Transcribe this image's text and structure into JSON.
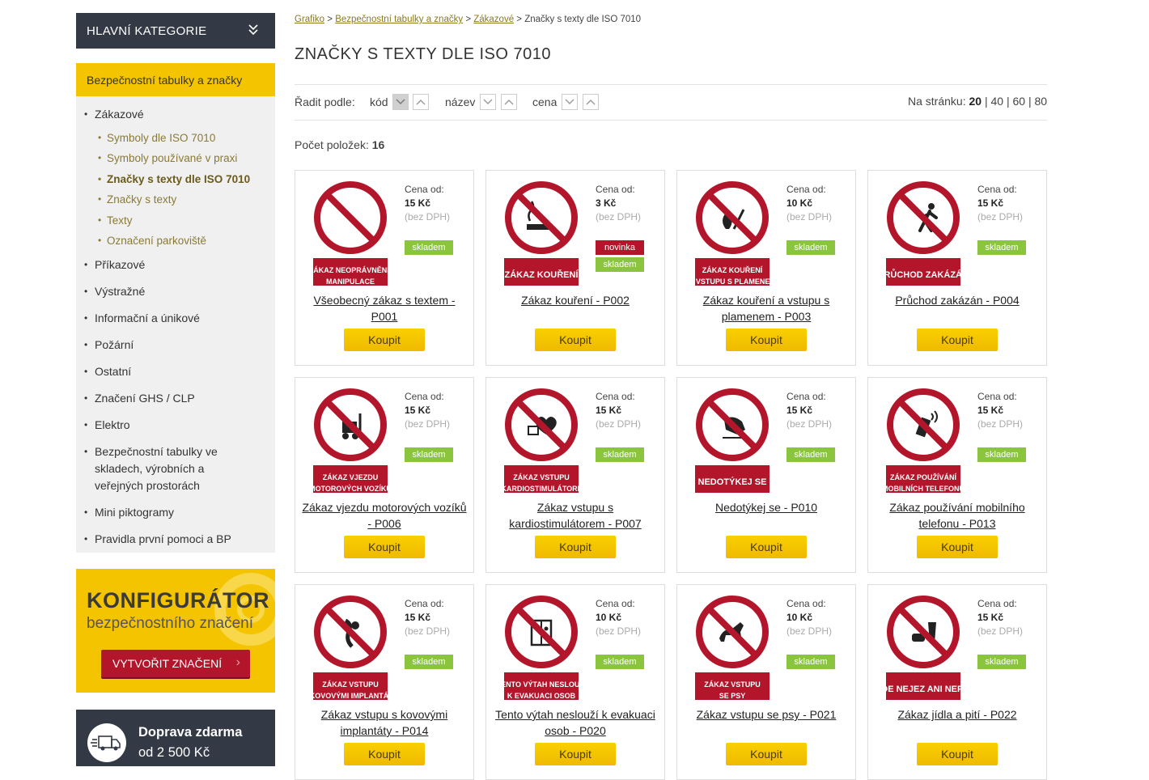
{
  "sidebar": {
    "header": "HLAVNÍ KATEGORIE",
    "active_category": "Bezpečnostní tabulky a značky",
    "items": [
      {
        "label": "Zákazové"
      },
      {
        "label": "Příkazové"
      },
      {
        "label": "Výstražné"
      },
      {
        "label": "Informační a únikové"
      },
      {
        "label": "Požární"
      },
      {
        "label": "Ostatní"
      },
      {
        "label": "Značení GHS / CLP"
      },
      {
        "label": "Elektro"
      },
      {
        "label": "Bezpečnostní tabulky ve skladech, výrobních a veřejných prostorách"
      },
      {
        "label": "Mini piktogramy"
      },
      {
        "label": "Pravidla první pomoci a BP"
      }
    ],
    "subitems": [
      {
        "label": "Symboly dle ISO 7010"
      },
      {
        "label": "Symboly používané v praxi"
      },
      {
        "label": "Značky s texty dle ISO 7010"
      },
      {
        "label": "Značky s texty"
      },
      {
        "label": "Texty"
      },
      {
        "label": "Označení parkoviště"
      }
    ],
    "konfigurator": {
      "title": "KONFIGURÁTOR",
      "subtitle": "bezpečnostního značení",
      "button": "VYTVOŘIT ZNAČENÍ"
    },
    "shipping": {
      "line1": "Doprava zdarma",
      "line2": "od 2 500 Kč"
    }
  },
  "breadcrumb": {
    "items": [
      "Grafiko",
      "Bezpečnostní tabulky a značky",
      "Zákazové"
    ],
    "current": "Značky s texty dle ISO 7010",
    "separator": ">"
  },
  "page_title": "ZNAČKY S TEXTY DLE ISO 7010",
  "sort": {
    "label": "Řadit podle:",
    "keys": [
      "kód",
      "název",
      "cena"
    ]
  },
  "per_page": {
    "label": "Na stránku:",
    "options": [
      "20",
      "40",
      "60",
      "80"
    ],
    "selected": "20"
  },
  "count": {
    "label": "Počet položek:",
    "value": "16"
  },
  "common": {
    "price_label": "Cena od:",
    "price_note": "(bez DPH)",
    "buy": "Koupit",
    "stock": "skladem",
    "new": "novinka"
  },
  "colors": {
    "accent": "#f5c400",
    "dark": "#333a45",
    "sign_red": "#b3152b",
    "stock_green": "#8bc53f"
  },
  "products": [
    {
      "name": "Všeobecný zákaz s textem - P001",
      "price": "15 Kč",
      "sign_text": [
        "ZÁKAZ NEOPRÁVNĚNÉ",
        "MANIPULACE"
      ],
      "pictogram": "general-prohibition-icon"
    },
    {
      "name": "Zákaz kouření - P002",
      "price": "3 Kč",
      "sign_text": [
        "ZÁKAZ KOUŘENÍ"
      ],
      "pictogram": "no-smoking-icon",
      "new": true
    },
    {
      "name": "Zákaz kouření a vstupu s plamenem - P003",
      "price": "10 Kč",
      "sign_text": [
        "ZÁKAZ KOUŘENÍ",
        "A VSTUPU S PLAMENEM"
      ],
      "pictogram": "no-flame-icon"
    },
    {
      "name": "Průchod zakázán - P004",
      "price": "15 Kč",
      "sign_text": [
        "PRŮCHOD ZAKÁZÁN"
      ],
      "pictogram": "no-pedestrian-icon"
    },
    {
      "name": "Zákaz vjezdu motorových vozíků - P006",
      "price": "15 Kč",
      "sign_text": [
        "ZÁKAZ VJEZDU",
        "MOTOROVÝCH VOZÍKŮ"
      ],
      "pictogram": "no-forklift-icon"
    },
    {
      "name": "Zákaz vstupu s kardiostimulátorem - P007",
      "price": "15 Kč",
      "sign_text": [
        "ZÁKAZ VSTUPU",
        "S KARDIOSTIMULÁTOREM"
      ],
      "pictogram": "no-pacemaker-icon"
    },
    {
      "name": "Nedotýkej se - P010",
      "price": "15 Kč",
      "sign_text": [
        "NEDOTÝKEJ SE"
      ],
      "pictogram": "no-touch-icon"
    },
    {
      "name": "Zákaz používání mobilního telefonu - P013",
      "price": "15 Kč",
      "sign_text": [
        "ZÁKAZ POUŽÍVÁNÍ",
        "MOBILNÍCH TELEFONŮ"
      ],
      "pictogram": "no-phone-icon"
    },
    {
      "name": "Zákaz vstupu s kovovými implantáty - P014",
      "price": "15 Kč",
      "sign_text": [
        "ZÁKAZ VSTUPU",
        "S KOVOVÝMI IMPLANTÁTY"
      ],
      "pictogram": "no-implant-icon"
    },
    {
      "name": "Tento výtah neslouží k evakuaci osob - P020",
      "price": "10 Kč",
      "sign_text": [
        "TENTO VÝTAH NESLOUŽÍ",
        "K EVAKUACI OSOB"
      ],
      "pictogram": "no-elevator-icon"
    },
    {
      "name": "Zákaz vstupu se psy - P021",
      "price": "10 Kč",
      "sign_text": [
        "ZÁKAZ VSTUPU",
        "SE PSY"
      ],
      "pictogram": "no-dogs-icon"
    },
    {
      "name": "Zákaz jídla a pití - P022",
      "price": "15 Kč",
      "sign_text": [
        "ZDE NEJEZ ANI NEPIJ"
      ],
      "pictogram": "no-food-icon"
    }
  ]
}
